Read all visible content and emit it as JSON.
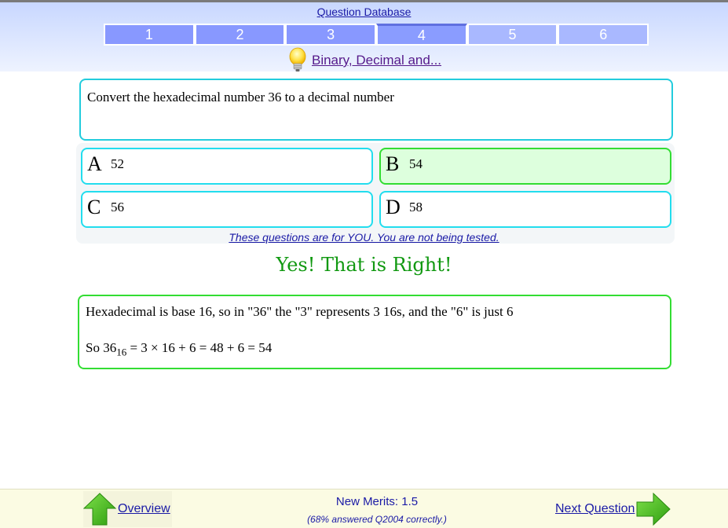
{
  "header": {
    "db_link": "Question Database",
    "tabs": [
      {
        "label": "1",
        "state": "done"
      },
      {
        "label": "2",
        "state": "done"
      },
      {
        "label": "3",
        "state": "done"
      },
      {
        "label": "4",
        "state": "current"
      },
      {
        "label": "5",
        "state": "upcoming"
      },
      {
        "label": "6",
        "state": "upcoming"
      }
    ],
    "topic_icon": "lightbulb-icon",
    "topic_link": "Binary, Decimal and..."
  },
  "question": {
    "text": "Convert the hexadecimal number 36 to a decimal number"
  },
  "answers": [
    {
      "letter": "A",
      "value": "52"
    },
    {
      "letter": "B",
      "value": "54",
      "selected": true,
      "correct": true
    },
    {
      "letter": "C",
      "value": "56"
    },
    {
      "letter": "D",
      "value": "58"
    }
  ],
  "not_tested": "These questions are for YOU. You are not being tested.",
  "result": "Yes! That is Right!",
  "explanation": {
    "line1": "Hexadecimal is base 16, so in \"36\" the \"3\" represents 3 16s, and the \"6\" is just 6",
    "line2_prefix": "So 36",
    "line2_sub": "16",
    "line2_suffix": " = 3 × 16 + 6 = 48 + 6 = 54"
  },
  "footer": {
    "overview_icon": "up-arrow-icon",
    "overview_label": "Overview",
    "merits": "New Merits: 1.5",
    "percent": "(68% answered Q2004 correctly.)",
    "next_label": "Next Question",
    "next_icon": "right-arrow-icon"
  },
  "colors": {
    "correct_bg": "#ddffdd",
    "correct_border": "#33dd33",
    "answer_border": "#22ddee",
    "result_text": "#119911",
    "tab_done": "#8898ff",
    "tab_upcoming": "#a9b8ff"
  }
}
